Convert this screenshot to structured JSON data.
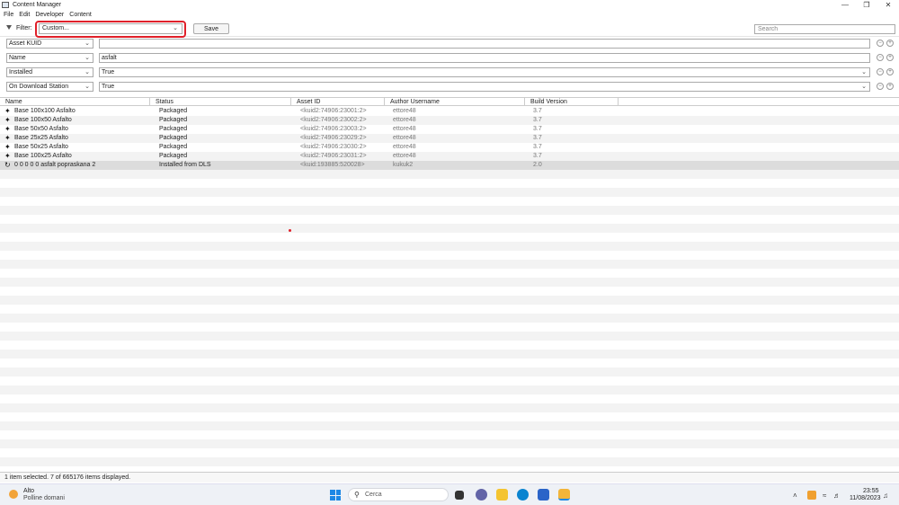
{
  "window": {
    "title": "Content Manager"
  },
  "menu": [
    "File",
    "Edit",
    "Developer",
    "Content"
  ],
  "filterbar": {
    "label": "Filter:",
    "selected": "Custom...",
    "save_label": "Save",
    "search_placeholder": "Search"
  },
  "filters": [
    {
      "field": "Asset KUID",
      "value": "",
      "has_dropdown": false
    },
    {
      "field": "Name",
      "value": "asfalt",
      "has_dropdown": false
    },
    {
      "field": "Installed",
      "value": "True",
      "has_dropdown": true
    },
    {
      "field": "On Download Station",
      "value": "True",
      "has_dropdown": true
    }
  ],
  "table": {
    "columns": [
      "Name",
      "Status",
      "Asset ID",
      "Author Username",
      "Build Version"
    ],
    "rows": [
      {
        "name": "Base 100x100 Asfalto",
        "status": "Packaged",
        "asset_id": "<kuid2:74906:23001:2>",
        "author": "ettore48",
        "build": "3.7",
        "icon": "puzzle-icon"
      },
      {
        "name": "Base 100x50 Asfalto",
        "status": "Packaged",
        "asset_id": "<kuid2:74906:23002:2>",
        "author": "ettore48",
        "build": "3.7",
        "icon": "puzzle-icon"
      },
      {
        "name": "Base 50x50 Asfalto",
        "status": "Packaged",
        "asset_id": "<kuid2:74906:23003:2>",
        "author": "ettore48",
        "build": "3.7",
        "icon": "puzzle-icon"
      },
      {
        "name": "Base 25x25 Asfalto",
        "status": "Packaged",
        "asset_id": "<kuid2:74906:23029:2>",
        "author": "ettore48",
        "build": "3.7",
        "icon": "puzzle-icon"
      },
      {
        "name": "Base 50x25 Asfalto",
        "status": "Packaged",
        "asset_id": "<kuid2:74906:23030:2>",
        "author": "ettore48",
        "build": "3.7",
        "icon": "puzzle-icon"
      },
      {
        "name": "Base 100x25 Asfalto",
        "status": "Packaged",
        "asset_id": "<kuid2:74906:23031:2>",
        "author": "ettore48",
        "build": "3.7",
        "icon": "puzzle-icon"
      },
      {
        "name": "0 0 0 0 0 asfalt popraskana 2",
        "status": "Installed from DLS",
        "asset_id": "<kuid:193885:520028>",
        "author": "kukuk2",
        "build": "2.0",
        "icon": "download-puzzle-icon",
        "selected": true
      }
    ]
  },
  "status": {
    "text": "1 item selected. 7 of 665176 items displayed."
  },
  "taskbar": {
    "weather_title": "Alto",
    "weather_sub": "Polline domani",
    "search_text": "Cerca",
    "time": "23:55",
    "date": "11/08/2023"
  },
  "colors": {
    "highlight": "#e0202a",
    "selected_row": "#dcdcdc",
    "alt_row": "#f3f3f3"
  }
}
